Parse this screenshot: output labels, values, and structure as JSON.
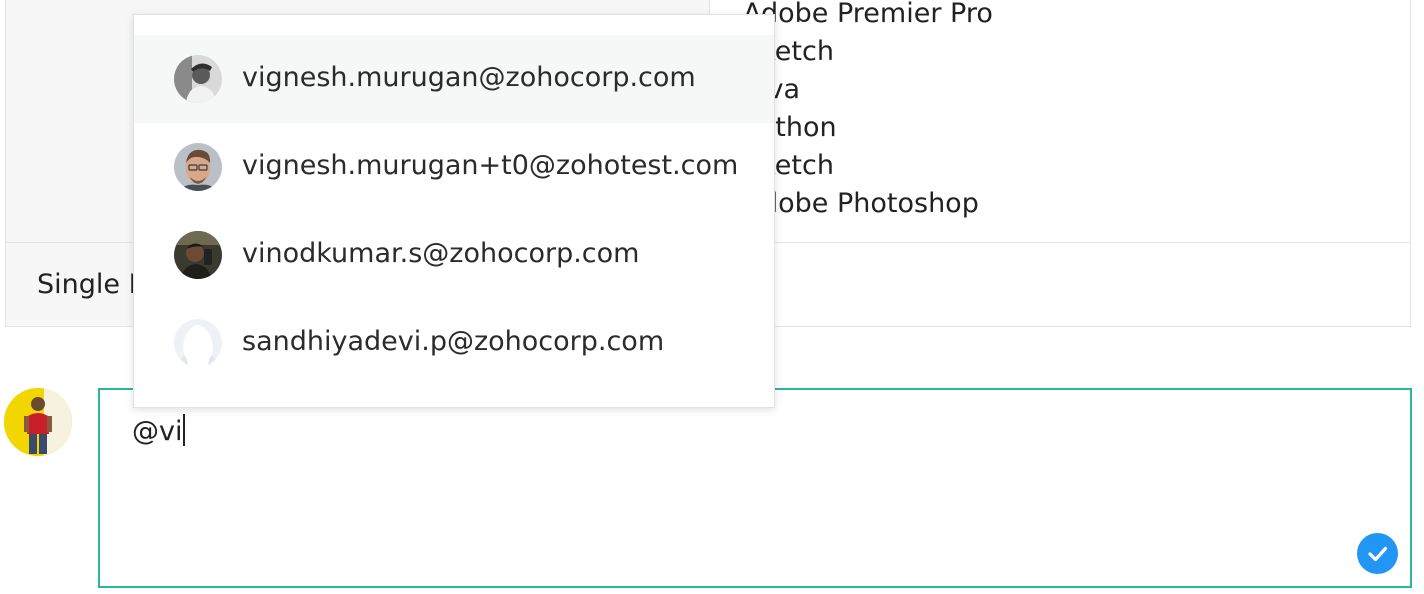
{
  "table": {
    "values": [
      "Adobe Premier Pro",
      "Sketch",
      "Java",
      "Python",
      "Sketch",
      "Adobe Photoshop"
    ],
    "row2_label": "Single Line"
  },
  "comment": {
    "text": "@vi",
    "current_user_avatar": "user-photo",
    "submit_icon": "check-icon",
    "border_color": "#2bb6a0",
    "submit_color": "#2196f3"
  },
  "mention_suggestions": [
    {
      "email": "vignesh.murugan@zohocorp.com",
      "avatar": "user-photo",
      "highlighted": true
    },
    {
      "email": "vignesh.murugan+t0@zohotest.com",
      "avatar": "user-photo",
      "highlighted": false
    },
    {
      "email": "vinodkumar.s@zohocorp.com",
      "avatar": "user-photo",
      "highlighted": false
    },
    {
      "email": "sandhiyadevi.p@zohocorp.com",
      "avatar": "default-avatar-icon",
      "highlighted": false
    }
  ]
}
